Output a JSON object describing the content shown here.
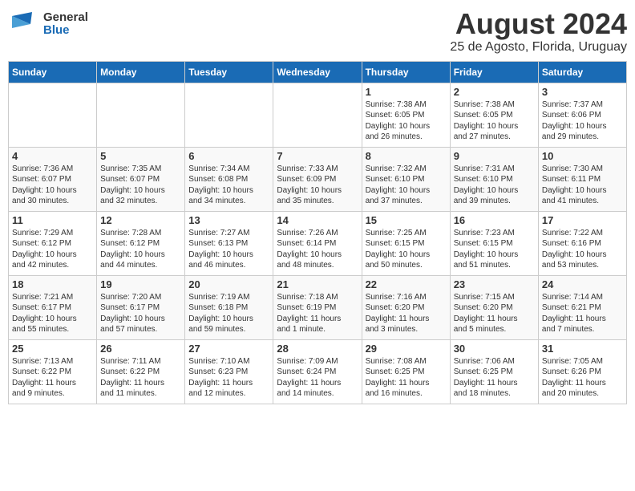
{
  "logo": {
    "line1": "General",
    "line2": "Blue"
  },
  "title": "August 2024",
  "subtitle": "25 de Agosto, Florida, Uruguay",
  "weekdays": [
    "Sunday",
    "Monday",
    "Tuesday",
    "Wednesday",
    "Thursday",
    "Friday",
    "Saturday"
  ],
  "weeks": [
    [
      {
        "day": "",
        "info": ""
      },
      {
        "day": "",
        "info": ""
      },
      {
        "day": "",
        "info": ""
      },
      {
        "day": "",
        "info": ""
      },
      {
        "day": "1",
        "info": "Sunrise: 7:38 AM\nSunset: 6:05 PM\nDaylight: 10 hours\nand 26 minutes."
      },
      {
        "day": "2",
        "info": "Sunrise: 7:38 AM\nSunset: 6:05 PM\nDaylight: 10 hours\nand 27 minutes."
      },
      {
        "day": "3",
        "info": "Sunrise: 7:37 AM\nSunset: 6:06 PM\nDaylight: 10 hours\nand 29 minutes."
      }
    ],
    [
      {
        "day": "4",
        "info": "Sunrise: 7:36 AM\nSunset: 6:07 PM\nDaylight: 10 hours\nand 30 minutes."
      },
      {
        "day": "5",
        "info": "Sunrise: 7:35 AM\nSunset: 6:07 PM\nDaylight: 10 hours\nand 32 minutes."
      },
      {
        "day": "6",
        "info": "Sunrise: 7:34 AM\nSunset: 6:08 PM\nDaylight: 10 hours\nand 34 minutes."
      },
      {
        "day": "7",
        "info": "Sunrise: 7:33 AM\nSunset: 6:09 PM\nDaylight: 10 hours\nand 35 minutes."
      },
      {
        "day": "8",
        "info": "Sunrise: 7:32 AM\nSunset: 6:10 PM\nDaylight: 10 hours\nand 37 minutes."
      },
      {
        "day": "9",
        "info": "Sunrise: 7:31 AM\nSunset: 6:10 PM\nDaylight: 10 hours\nand 39 minutes."
      },
      {
        "day": "10",
        "info": "Sunrise: 7:30 AM\nSunset: 6:11 PM\nDaylight: 10 hours\nand 41 minutes."
      }
    ],
    [
      {
        "day": "11",
        "info": "Sunrise: 7:29 AM\nSunset: 6:12 PM\nDaylight: 10 hours\nand 42 minutes."
      },
      {
        "day": "12",
        "info": "Sunrise: 7:28 AM\nSunset: 6:12 PM\nDaylight: 10 hours\nand 44 minutes."
      },
      {
        "day": "13",
        "info": "Sunrise: 7:27 AM\nSunset: 6:13 PM\nDaylight: 10 hours\nand 46 minutes."
      },
      {
        "day": "14",
        "info": "Sunrise: 7:26 AM\nSunset: 6:14 PM\nDaylight: 10 hours\nand 48 minutes."
      },
      {
        "day": "15",
        "info": "Sunrise: 7:25 AM\nSunset: 6:15 PM\nDaylight: 10 hours\nand 50 minutes."
      },
      {
        "day": "16",
        "info": "Sunrise: 7:23 AM\nSunset: 6:15 PM\nDaylight: 10 hours\nand 51 minutes."
      },
      {
        "day": "17",
        "info": "Sunrise: 7:22 AM\nSunset: 6:16 PM\nDaylight: 10 hours\nand 53 minutes."
      }
    ],
    [
      {
        "day": "18",
        "info": "Sunrise: 7:21 AM\nSunset: 6:17 PM\nDaylight: 10 hours\nand 55 minutes."
      },
      {
        "day": "19",
        "info": "Sunrise: 7:20 AM\nSunset: 6:17 PM\nDaylight: 10 hours\nand 57 minutes."
      },
      {
        "day": "20",
        "info": "Sunrise: 7:19 AM\nSunset: 6:18 PM\nDaylight: 10 hours\nand 59 minutes."
      },
      {
        "day": "21",
        "info": "Sunrise: 7:18 AM\nSunset: 6:19 PM\nDaylight: 11 hours\nand 1 minute."
      },
      {
        "day": "22",
        "info": "Sunrise: 7:16 AM\nSunset: 6:20 PM\nDaylight: 11 hours\nand 3 minutes."
      },
      {
        "day": "23",
        "info": "Sunrise: 7:15 AM\nSunset: 6:20 PM\nDaylight: 11 hours\nand 5 minutes."
      },
      {
        "day": "24",
        "info": "Sunrise: 7:14 AM\nSunset: 6:21 PM\nDaylight: 11 hours\nand 7 minutes."
      }
    ],
    [
      {
        "day": "25",
        "info": "Sunrise: 7:13 AM\nSunset: 6:22 PM\nDaylight: 11 hours\nand 9 minutes."
      },
      {
        "day": "26",
        "info": "Sunrise: 7:11 AM\nSunset: 6:22 PM\nDaylight: 11 hours\nand 11 minutes."
      },
      {
        "day": "27",
        "info": "Sunrise: 7:10 AM\nSunset: 6:23 PM\nDaylight: 11 hours\nand 12 minutes."
      },
      {
        "day": "28",
        "info": "Sunrise: 7:09 AM\nSunset: 6:24 PM\nDaylight: 11 hours\nand 14 minutes."
      },
      {
        "day": "29",
        "info": "Sunrise: 7:08 AM\nSunset: 6:25 PM\nDaylight: 11 hours\nand 16 minutes."
      },
      {
        "day": "30",
        "info": "Sunrise: 7:06 AM\nSunset: 6:25 PM\nDaylight: 11 hours\nand 18 minutes."
      },
      {
        "day": "31",
        "info": "Sunrise: 7:05 AM\nSunset: 6:26 PM\nDaylight: 11 hours\nand 20 minutes."
      }
    ]
  ]
}
